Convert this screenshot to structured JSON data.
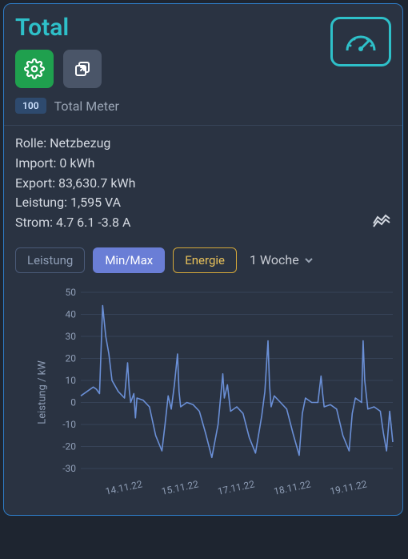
{
  "title": "Total",
  "badge": {
    "number": "100",
    "label": "Total Meter"
  },
  "metrics": {
    "role_label": "Rolle:",
    "role_value": "Netzbezug",
    "import_label": "Import:",
    "import_value": "0 kWh",
    "export_label": "Export:",
    "export_value": "83,630.7 kWh",
    "power_label": "Leistung:",
    "power_value": "1,595 VA",
    "current_label": "Strom:",
    "current_value": "4.7 6.1 -3.8 A"
  },
  "tabs": {
    "leistung": "Leistung",
    "minmax": "Min/Max",
    "energie": "Energie"
  },
  "range": {
    "label": "1 Woche"
  },
  "chart_data": {
    "type": "line",
    "title": "",
    "xlabel": "",
    "ylabel": "Leistung / kW",
    "ylim": [
      -30,
      50
    ],
    "yticks": [
      -30,
      -20,
      -10,
      0,
      10,
      20,
      30,
      40,
      50
    ],
    "xticks": [
      "14.11.22",
      "15.11.22",
      "17.11.22",
      "18.11.22",
      "19.11.22"
    ],
    "x": [
      0,
      0.02,
      0.04,
      0.05,
      0.06,
      0.07,
      0.08,
      0.09,
      0.1,
      0.12,
      0.14,
      0.15,
      0.155,
      0.16,
      0.17,
      0.175,
      0.18,
      0.2,
      0.22,
      0.24,
      0.26,
      0.27,
      0.28,
      0.29,
      0.3,
      0.31,
      0.315,
      0.32,
      0.34,
      0.36,
      0.38,
      0.4,
      0.42,
      0.44,
      0.455,
      0.46,
      0.47,
      0.48,
      0.5,
      0.52,
      0.54,
      0.56,
      0.58,
      0.59,
      0.6,
      0.605,
      0.61,
      0.62,
      0.64,
      0.66,
      0.68,
      0.7,
      0.71,
      0.72,
      0.74,
      0.76,
      0.77,
      0.775,
      0.78,
      0.8,
      0.82,
      0.84,
      0.86,
      0.87,
      0.88,
      0.9,
      0.905,
      0.91,
      0.92,
      0.94,
      0.96,
      0.97,
      0.98,
      0.99,
      1.0
    ],
    "series": [
      {
        "name": "Leistung",
        "values": [
          3,
          5,
          7,
          6,
          4,
          44,
          30,
          22,
          10,
          5,
          2,
          18,
          6,
          0,
          4,
          -7,
          2,
          1,
          -2,
          -15,
          -22,
          -10,
          3,
          -3,
          8,
          22,
          5,
          -2,
          0,
          -1,
          -4,
          -14,
          -25,
          -10,
          13,
          2,
          8,
          -4,
          -2,
          -5,
          -16,
          -23,
          -6,
          5,
          28,
          8,
          -2,
          3,
          0,
          -3,
          -14,
          -24,
          -5,
          2,
          0,
          0,
          12,
          4,
          -2,
          -1,
          -3,
          -15,
          -22,
          -5,
          2,
          0,
          28,
          10,
          -3,
          -2,
          -4,
          -14,
          -22,
          -4,
          -18
        ]
      }
    ]
  }
}
